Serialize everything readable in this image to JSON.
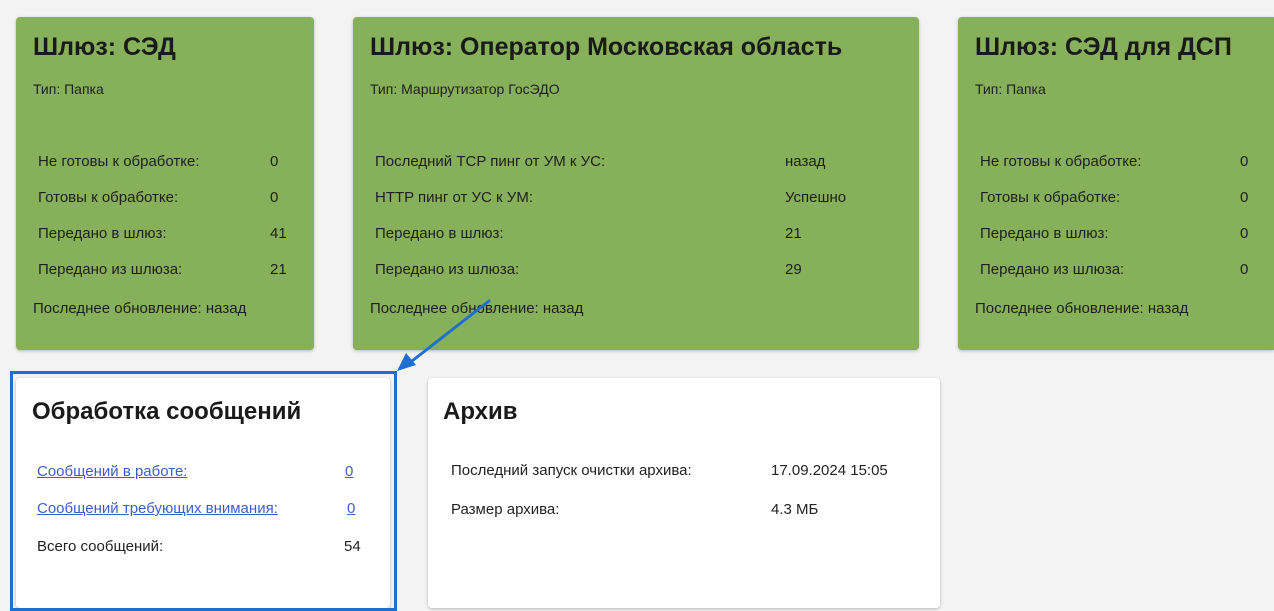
{
  "gateways": [
    {
      "title": "Шлюз: СЭД",
      "type": "Тип: Папка",
      "rows": [
        {
          "label": "Не готовы к обработке:",
          "value": "0"
        },
        {
          "label": "Готовы к обработке:",
          "value": "0"
        },
        {
          "label": "Передано в шлюз:",
          "value": "41"
        },
        {
          "label": "Передано из шлюза:",
          "value": "21"
        }
      ],
      "updated": "Последнее обновление: назад"
    },
    {
      "title": "Шлюз: Оператор Московская область",
      "type": "Тип: Маршрутизатор ГосЭДО",
      "rows": [
        {
          "label": "Последний TCP пинг от УМ к УС:",
          "value": "назад"
        },
        {
          "label": "HTTP пинг от УС к УМ:",
          "value": "Успешно"
        },
        {
          "label": "Передано в шлюз:",
          "value": "21"
        },
        {
          "label": "Передано из шлюза:",
          "value": "29"
        }
      ],
      "updated": "Последнее обновление: назад"
    },
    {
      "title": "Шлюз: СЭД для ДСП",
      "type": "Тип: Папка",
      "rows": [
        {
          "label": "Не готовы к обработке:",
          "value": "0"
        },
        {
          "label": "Готовы к обработке:",
          "value": "0"
        },
        {
          "label": "Передано в шлюз:",
          "value": "0"
        },
        {
          "label": "Передано из шлюза:",
          "value": "0"
        }
      ],
      "updated": "Последнее обновление: назад"
    }
  ],
  "processing": {
    "title": "Обработка сообщений",
    "rows": [
      {
        "label": "Сообщений в работе:",
        "value": "0"
      },
      {
        "label": "Сообщений требующих внимания:",
        "value": "0"
      },
      {
        "label": "Всего сообщений:",
        "value": "54"
      }
    ]
  },
  "archive": {
    "title": "Архив",
    "rows": [
      {
        "label": "Последний запуск очистки архива:",
        "value": "17.09.2024 15:05"
      },
      {
        "label": "Размер архива:",
        "value": "4.3 МБ"
      }
    ]
  },
  "colors": {
    "gateway_bg": "#86b05a",
    "link": "#3a5fcd",
    "highlight": "#1e6fcf",
    "page_bg": "#f3f3f3"
  }
}
